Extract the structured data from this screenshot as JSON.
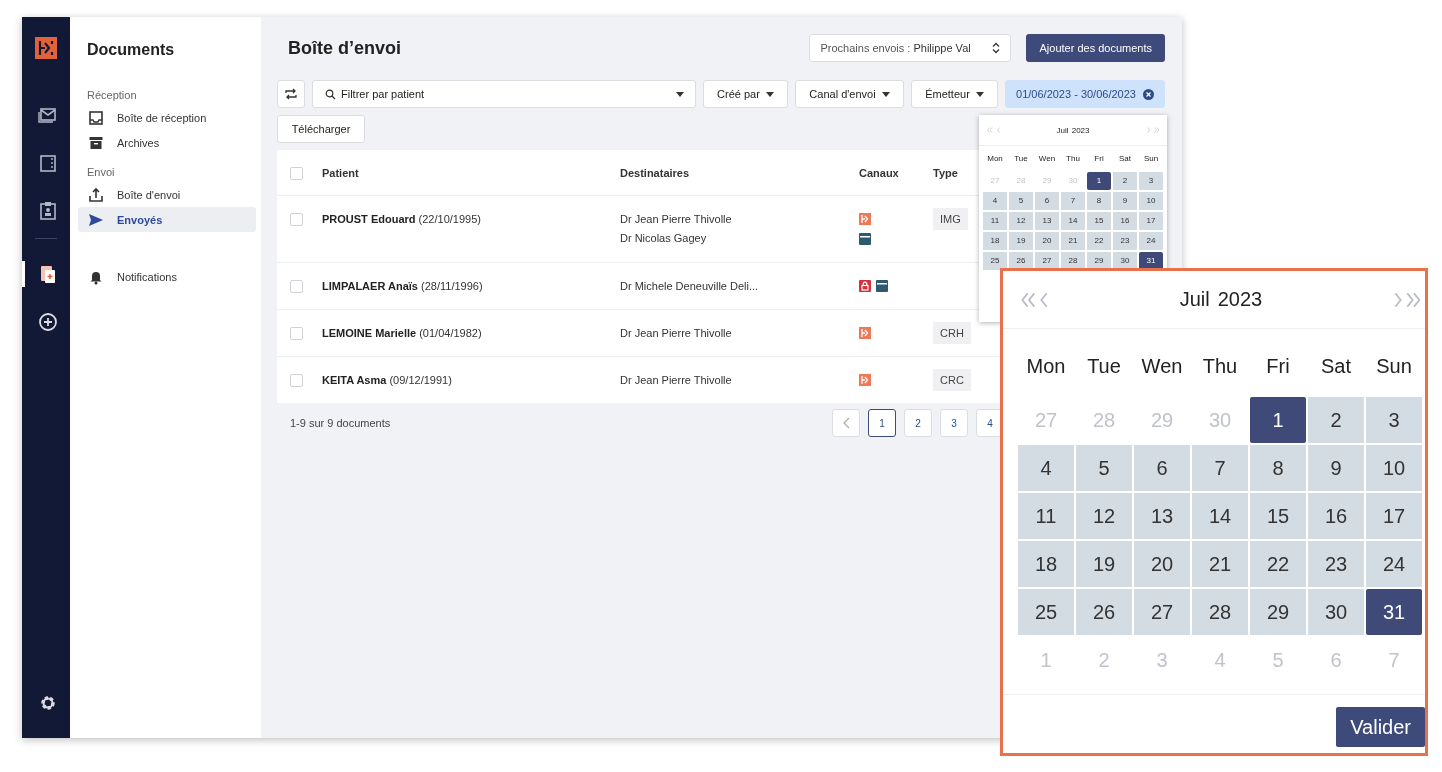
{
  "rail": [
    {
      "kind": "mail",
      "selected": false
    },
    {
      "kind": "book",
      "selected": false
    },
    {
      "kind": "clipboard",
      "selected": false
    },
    {
      "kind": "documents",
      "selected": true
    },
    {
      "kind": "add",
      "selected": false
    }
  ],
  "sidebar": {
    "title": "Documents",
    "sections": [
      {
        "label": "Réception",
        "items": [
          {
            "label": "Boîte de réception",
            "kind": "inbox",
            "selected": false
          },
          {
            "label": "Archives",
            "kind": "archive",
            "selected": false
          }
        ]
      },
      {
        "label": "Envoi",
        "items": [
          {
            "label": "Boîte d'envoi",
            "kind": "outbox",
            "selected": false
          },
          {
            "label": "Envoyés",
            "kind": "send",
            "selected": true
          }
        ]
      }
    ],
    "extra": [
      {
        "label": "Notifications",
        "kind": "bell",
        "selected": false
      }
    ]
  },
  "page_title": "Boîte d’envoi",
  "sender_select": {
    "label": "Prochains envois : ",
    "value": "Philippe Val"
  },
  "add_button": "Ajouter des documents",
  "filters": {
    "search_placeholder": "Filtrer par patient",
    "dropdowns": [
      "Créé par",
      "Canal d'envoi",
      "Émetteur"
    ],
    "date_range": "01/06/2023 - 30/06/2023"
  },
  "download_button": "Télécharger",
  "table": {
    "select_all_checked": false,
    "columns": [
      "Patient",
      "Destinataires",
      "Canaux",
      "Type"
    ],
    "rows": [
      {
        "checked": false,
        "patient": "**PROUST Edouard** (22/10/1995)",
        "recipients": [
          "Dr Jean Pierre Thivolle",
          "Dr Nicolas Gagey"
        ],
        "channels": [
          {
            "kind": "logo"
          },
          {
            "kind": "card"
          }
        ],
        "type": "IMG"
      },
      {
        "checked": false,
        "patient": "**LIMPALAER Anaïs** (28/11/1996)",
        "recipients": [
          "Dr Michele Deneuville Deli..."
        ],
        "channels": [
          {
            "kind": "secure"
          },
          {
            "kind": "card"
          }
        ]
      },
      {
        "checked": false,
        "patient": "**LEMOINE Marielle** (01/04/1982)",
        "recipients": [
          "Dr Jean Pierre Thivolle"
        ],
        "channels": [
          {
            "kind": "logo"
          }
        ],
        "type": "CRH"
      },
      {
        "checked": false,
        "patient": "**KEITA Asma** (09/12/1991)",
        "recipients": [
          "Dr Jean Pierre Thivolle"
        ],
        "channels": [
          {
            "kind": "logo"
          }
        ],
        "type": "CRC"
      }
    ]
  },
  "footer": {
    "count": "1-9 sur 9 documents",
    "pages": [
      {
        "label": "1",
        "selected": true
      },
      {
        "label": "2",
        "selected": false
      },
      {
        "label": "3",
        "selected": false
      },
      {
        "label": "4",
        "selected": false
      }
    ]
  },
  "date_picker": {
    "month": "Juil",
    "year": "2023",
    "weekdays": [
      "Mon",
      "Tue",
      "Wen",
      "Thu",
      "Fri",
      "Sat",
      "Sun"
    ],
    "weeks": [
      [
        {
          "d": "27",
          "kind": "muted"
        },
        {
          "d": "28",
          "kind": "muted"
        },
        {
          "d": "29",
          "kind": "muted"
        },
        {
          "d": "30",
          "kind": "muted"
        },
        {
          "d": "1",
          "kind": "edge"
        },
        {
          "d": "2",
          "kind": "range"
        },
        {
          "d": "3",
          "kind": "range"
        }
      ],
      [
        {
          "d": "4",
          "kind": "range"
        },
        {
          "d": "5",
          "kind": "range"
        },
        {
          "d": "6",
          "kind": "range"
        },
        {
          "d": "7",
          "kind": "range"
        },
        {
          "d": "8",
          "kind": "range"
        },
        {
          "d": "9",
          "kind": "range"
        },
        {
          "d": "10",
          "kind": "range"
        }
      ],
      [
        {
          "d": "11",
          "kind": "range"
        },
        {
          "d": "12",
          "kind": "range"
        },
        {
          "d": "13",
          "kind": "range"
        },
        {
          "d": "14",
          "kind": "range"
        },
        {
          "d": "15",
          "kind": "range"
        },
        {
          "d": "16",
          "kind": "range"
        },
        {
          "d": "17",
          "kind": "range"
        }
      ],
      [
        {
          "d": "18",
          "kind": "range"
        },
        {
          "d": "19",
          "kind": "range"
        },
        {
          "d": "20",
          "kind": "range"
        },
        {
          "d": "21",
          "kind": "range"
        },
        {
          "d": "22",
          "kind": "range"
        },
        {
          "d": "23",
          "kind": "range"
        },
        {
          "d": "24",
          "kind": "range"
        }
      ],
      [
        {
          "d": "25",
          "kind": "range"
        },
        {
          "d": "26",
          "kind": "range"
        },
        {
          "d": "27",
          "kind": "range"
        },
        {
          "d": "28",
          "kind": "range"
        },
        {
          "d": "29",
          "kind": "range"
        },
        {
          "d": "30",
          "kind": "range"
        },
        {
          "d": "31",
          "kind": "edge"
        }
      ]
    ]
  },
  "zoomed_date_picker": {
    "month": "Juil",
    "year": "2023",
    "weekdays": [
      "Mon",
      "Tue",
      "Wen",
      "Thu",
      "Fri",
      "Sat",
      "Sun"
    ],
    "weeks": [
      [
        {
          "d": "27",
          "kind": "muted"
        },
        {
          "d": "28",
          "kind": "muted"
        },
        {
          "d": "29",
          "kind": "muted"
        },
        {
          "d": "30",
          "kind": "muted"
        },
        {
          "d": "1",
          "kind": "edge"
        },
        {
          "d": "2",
          "kind": "range"
        },
        {
          "d": "3",
          "kind": "range"
        }
      ],
      [
        {
          "d": "4",
          "kind": "range"
        },
        {
          "d": "5",
          "kind": "range"
        },
        {
          "d": "6",
          "kind": "range"
        },
        {
          "d": "7",
          "kind": "range"
        },
        {
          "d": "8",
          "kind": "range"
        },
        {
          "d": "9",
          "kind": "range"
        },
        {
          "d": "10",
          "kind": "range"
        }
      ],
      [
        {
          "d": "11",
          "kind": "range"
        },
        {
          "d": "12",
          "kind": "range"
        },
        {
          "d": "13",
          "kind": "range"
        },
        {
          "d": "14",
          "kind": "range"
        },
        {
          "d": "15",
          "kind": "range"
        },
        {
          "d": "16",
          "kind": "range"
        },
        {
          "d": "17",
          "kind": "range"
        }
      ],
      [
        {
          "d": "18",
          "kind": "range"
        },
        {
          "d": "19",
          "kind": "range"
        },
        {
          "d": "20",
          "kind": "range"
        },
        {
          "d": "21",
          "kind": "range"
        },
        {
          "d": "22",
          "kind": "range"
        },
        {
          "d": "23",
          "kind": "range"
        },
        {
          "d": "24",
          "kind": "range"
        }
      ],
      [
        {
          "d": "25",
          "kind": "range"
        },
        {
          "d": "26",
          "kind": "range"
        },
        {
          "d": "27",
          "kind": "range"
        },
        {
          "d": "28",
          "kind": "range"
        },
        {
          "d": "29",
          "kind": "range"
        },
        {
          "d": "30",
          "kind": "range"
        },
        {
          "d": "31",
          "kind": "edge"
        }
      ],
      [
        {
          "d": "1",
          "kind": "muted"
        },
        {
          "d": "2",
          "kind": "muted"
        },
        {
          "d": "3",
          "kind": "muted"
        },
        {
          "d": "4",
          "kind": "muted"
        },
        {
          "d": "5",
          "kind": "muted"
        },
        {
          "d": "6",
          "kind": "muted"
        },
        {
          "d": "7",
          "kind": "muted"
        }
      ]
    ],
    "button": "Valider"
  }
}
